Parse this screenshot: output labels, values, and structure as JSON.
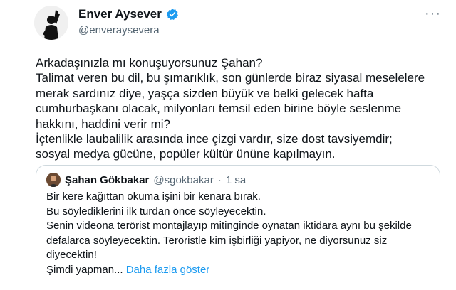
{
  "author": {
    "name": "Enver Aysever",
    "handle": "@enveraysevera",
    "more_label": "···"
  },
  "tweet": {
    "lines": [
      "Arkadaşınızla mı konuşuyorsunuz Şahan?",
      "Talimat veren bu dil, bu şımarıklık, son günlerde biraz siyasal meselelere",
      "merak sardınız diye, yaşça sizden büyük ve belki gelecek hafta",
      "cumhurbaşkanı olacak, milyonları temsil eden birine böyle seslenme",
      "hakkını, haddini verir mi?",
      "İçtenlikle laubalilik arasında ince çizgi vardır, size dost tavsiyemdir;",
      "sosyal medya gücüne, popüler kültür ününe kapılmayın."
    ]
  },
  "quote": {
    "name": "Şahan Gökbakar",
    "handle": "@sgokbakar",
    "separator": "·",
    "time": "1 sa",
    "lines": [
      "Bir kere kağıttan okuma işini bir kenara bırak.",
      "Bu söylediklerini ilk turdan önce söyleyecektin.",
      "Senin videona terörist montajlayıp mitinginde oynatan iktidara aynı bu şekilde",
      "defalarca söyleyecektin. Teröristle kim işbirliği yapiyor, ne diyorsunuz siz",
      "diyecektin!"
    ],
    "last_line": "Şimdi yapman...",
    "show_more": "Daha fazla göster"
  },
  "colors": {
    "accent": "#1d9bf0",
    "secondary_text": "#536471",
    "border": "#cfd9de"
  }
}
